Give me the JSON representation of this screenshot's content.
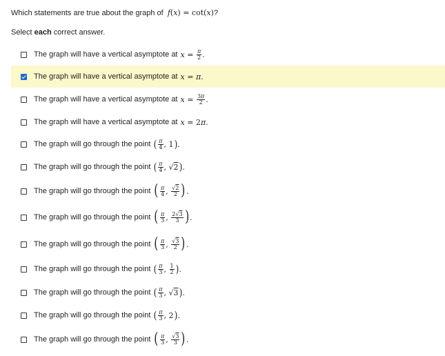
{
  "question": {
    "prefix": "Which statements are true about the graph of",
    "function": "f(x) = cot(x)",
    "suffix": "?"
  },
  "instruction": {
    "pre": "Select ",
    "bold": "each",
    "post": " correct answer."
  },
  "options": [
    {
      "text": "The graph will have a vertical asymptote at",
      "expr": "x = π/2",
      "checked": false
    },
    {
      "text": "The graph will have a vertical asymptote at",
      "expr": "x = π.",
      "checked": true
    },
    {
      "text": "The graph will have a vertical asymptote at",
      "expr": "x = 3π/2.",
      "checked": false
    },
    {
      "text": "The graph will have a vertical asymptote at",
      "expr": "x = 2π.",
      "checked": false
    },
    {
      "text": "The graph will go through the point",
      "expr": "(π/4, 1).",
      "checked": false
    },
    {
      "text": "The graph will go through the point",
      "expr": "(π/4, √2).",
      "checked": false
    },
    {
      "text": "The graph will go through the point",
      "expr": "(π/4, √2/2).",
      "checked": false
    },
    {
      "text": "The graph will go through the point",
      "expr": "(π/3, 2√3/3).",
      "checked": false
    },
    {
      "text": "The graph will go through the point",
      "expr": "(π/3, √3/2).",
      "checked": false
    },
    {
      "text": "The graph will go through the point",
      "expr": "(π/3, 1/2).",
      "checked": false
    },
    {
      "text": "The graph will go through the point",
      "expr": "(π/3, √3).",
      "checked": false
    },
    {
      "text": "The graph will go through the point",
      "expr": "(π/3, 2).",
      "checked": false
    },
    {
      "text": "The graph will go through the point",
      "expr": "(π/3, √3/3).",
      "checked": false
    }
  ],
  "colors": {
    "selected_bg": "#fbf8c9",
    "check_blue": "#1f66c8"
  }
}
